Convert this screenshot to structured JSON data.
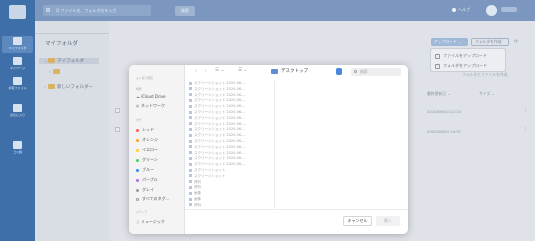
{
  "app": {
    "search_placeholder": "Q ファイル名、フォルダ名を入力",
    "search_button": "検索",
    "help_label": "ヘルプ",
    "accent": "#3f6fa8"
  },
  "rail": {
    "items": [
      {
        "label": "マイフォルダ",
        "icon": "folder-icon"
      },
      {
        "label": "マイページ",
        "icon": "desk-icon"
      },
      {
        "label": "共有ファイル",
        "icon": "link-icon"
      },
      {
        "label": "お気に入り",
        "icon": "star-icon"
      },
      {
        "label": "ゴミ箱",
        "icon": "trash-icon"
      }
    ]
  },
  "tree": {
    "title": "マイフォルダ",
    "items": [
      {
        "label": "マイフォルダ"
      },
      {
        "label": ""
      },
      {
        "label": "新しいフォルダー"
      }
    ]
  },
  "toolbar": {
    "upload_label": "アップロード ⌄",
    "new_folder_label": "フォルダを作成",
    "menu": [
      {
        "label": "ファイルをアップロード"
      },
      {
        "label": "フォルダをアップロード"
      }
    ],
    "footnote": "フォルダとファイルを作成"
  },
  "table": {
    "headers": {
      "updated": "最終更新日 ⌄",
      "size": "サイズ ⌄"
    },
    "rows": [
      {
        "updated": "2020/06/14 22:10"
      },
      {
        "updated": "2020/06/20 14:37"
      }
    ]
  },
  "dialog": {
    "sections": {
      "favorites": "よく使う項目",
      "locations": "場所",
      "tags": "タグ",
      "media": "メディア"
    },
    "favorites": [],
    "locations": [
      {
        "label": "iCloud Drive",
        "icon": "cloud-icon"
      },
      {
        "label": "ネットワーク",
        "icon": "globe-icon"
      }
    ],
    "tags": [
      {
        "label": "レッド",
        "color": "#ff5b52"
      },
      {
        "label": "オレンジ",
        "color": "#ffa628"
      },
      {
        "label": "イエロー",
        "color": "#ffd226"
      },
      {
        "label": "グリーン",
        "color": "#4bd45c"
      },
      {
        "label": "ブルー",
        "color": "#2f8cf7"
      },
      {
        "label": "パープル",
        "color": "#b46de0"
      },
      {
        "label": "グレイ",
        "color": "#9b9ba0"
      },
      {
        "label": "すべてのタグ...",
        "color": ""
      }
    ],
    "media": [
      {
        "label": "ミュージック",
        "icon": "music-icon"
      }
    ],
    "location": "デスクトップ",
    "search_placeholder": "検索",
    "files": [
      {
        "name": "スクリーンショット 2020-06-..."
      },
      {
        "name": "スクリーンショット 2020-06-..."
      },
      {
        "name": "スクリーンショット 2020-06-..."
      },
      {
        "name": "スクリーンショット 2020-06-..."
      },
      {
        "name": "スクリーンショット 2020-06-..."
      },
      {
        "name": "スクリーンショット 2020-06-..."
      },
      {
        "name": "スクリーンショット 2020-06-..."
      },
      {
        "name": "スクリーンショット 2020-06-..."
      },
      {
        "name": "スクリーンショット 2020-06-..."
      },
      {
        "name": "スクリーンショット 2020-06-..."
      },
      {
        "name": "スクリーンショット 2020-06-..."
      },
      {
        "name": "スクリーンショット 2020-06-..."
      },
      {
        "name": "スクリーンショット 2020-06-..."
      },
      {
        "name": "スクリーンショット 2020-06-..."
      },
      {
        "name": "スクリーンショット 2020-06-..."
      },
      {
        "name": "スクリーンショット"
      },
      {
        "name": "スクリーンショット"
      },
      {
        "name": "資料"
      },
      {
        "name": "資料"
      },
      {
        "name": "画像"
      },
      {
        "name": "画像"
      },
      {
        "name": "資料"
      }
    ],
    "cancel_label": "キャンセル",
    "open_label": "開く"
  }
}
